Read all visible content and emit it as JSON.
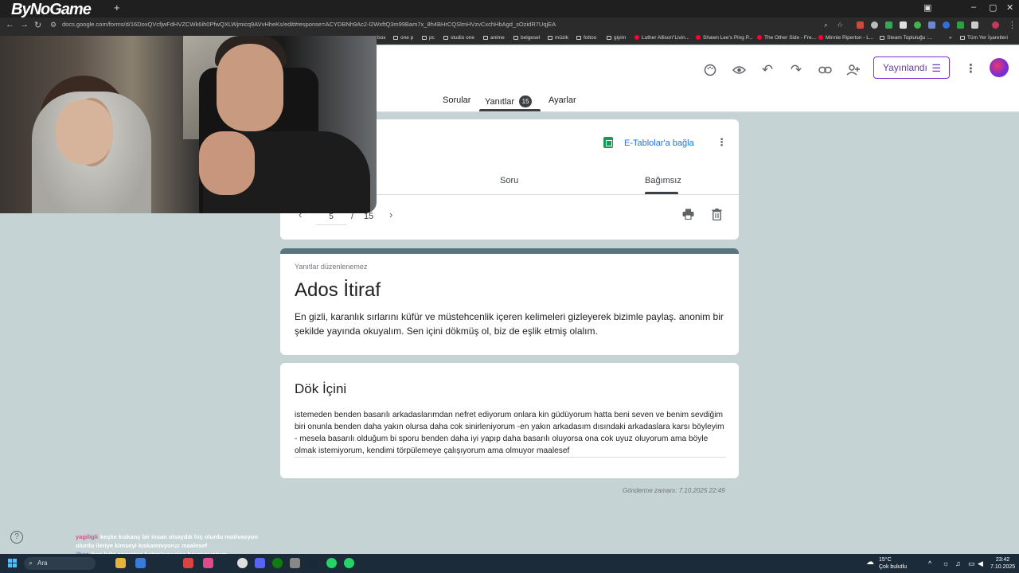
{
  "browser": {
    "brand": "ByNoGame",
    "url": "docs.google.com/forms/d/16DoxQVcfjwFdHVZCWk6ih0PfwQXLWjmicq9AVvHheKs/edit#response=ACYDBNh9Ac2-l2WxftQ3m99Bam7x_8h4BHrCQSlmHVzvCxchHbAgd_sOzidR7UqjEA",
    "bookmarks": [
      "box",
      "one p",
      "pc",
      "studio one",
      "anime",
      "belgesel",
      "müzik",
      "fottoo",
      "giyim",
      "Luther Allison\"Livin...",
      "Shawn Lee's Ping P...",
      "The Other Side - Fre...",
      "Minnie Riperton - L...",
      "Steam Topluluğu :...",
      "»",
      "Tüm Yer İşaretleri"
    ]
  },
  "header": {
    "publish_label": "Yayınlandı",
    "tabs": {
      "questions": "Sorular",
      "responses": "Yanıtlar",
      "responses_count": "15",
      "settings": "Ayarlar"
    }
  },
  "summary_card": {
    "sheets_link": "E-Tablolar'a bağla",
    "subtabs": [
      "Soru",
      "Bağımsız"
    ],
    "pager": {
      "current": "5",
      "separator": "/",
      "total": "15"
    }
  },
  "form": {
    "note": "Yanıtlar düzenlenemez",
    "title": "Ados İtiraf",
    "description": "En gizli, karanlık sırlarını küfür ve müstehcenlik içeren kelimeleri gizleyerek bizimle paylaş. anonim bir şekilde yayında okuyalım. Sen içini dökmüş ol, biz de eşlik etmiş olalım."
  },
  "question": {
    "title": "Dök İçini",
    "answer": "istemeden benden basarılı arkadaslarımdan nefret ediyorum onlara kin güdüyorum hatta beni seven ve benim sevdiğim biri onunla benden daha yakın olursa daha cok sinirleniyorum -en yakın arkadasım dısındaki arkadaslara karsı böyleyim - mesela basarılı olduğum bi sporu benden daha iyi yapıp daha basarılı oluyorsa ona cok uyuz oluyorum ama böyle olmak istemiyorum, kendimi törpülemeye çalışıyorum ama olmuyor maalesef"
  },
  "submitted": "Gönderme zamanı: 7.10.2025 22:49",
  "chat": [
    {
      "user": "yagiligli",
      "text": "keşke kıskanç bir insan olsaydık hiç olurdu motivasyon olurdu ileriye kimseyi kıskanmıyoruz maalesef"
    },
    {
      "user": "ilkao",
      "text": "ben hala çoraptan betimlemesine hayranıyorum"
    }
  ],
  "taskbar": {
    "search": "Ara",
    "weather_temp": "15°C",
    "weather_desc": "Çok bulutlu",
    "time": "23:42",
    "date": "7.10.2025"
  },
  "colors": {
    "accent": "#673ab7",
    "page_bg": "#c5d3d4",
    "header_band": "#5a7582",
    "sheets_green": "#0f9d58",
    "link_blue": "#1a73e8"
  }
}
